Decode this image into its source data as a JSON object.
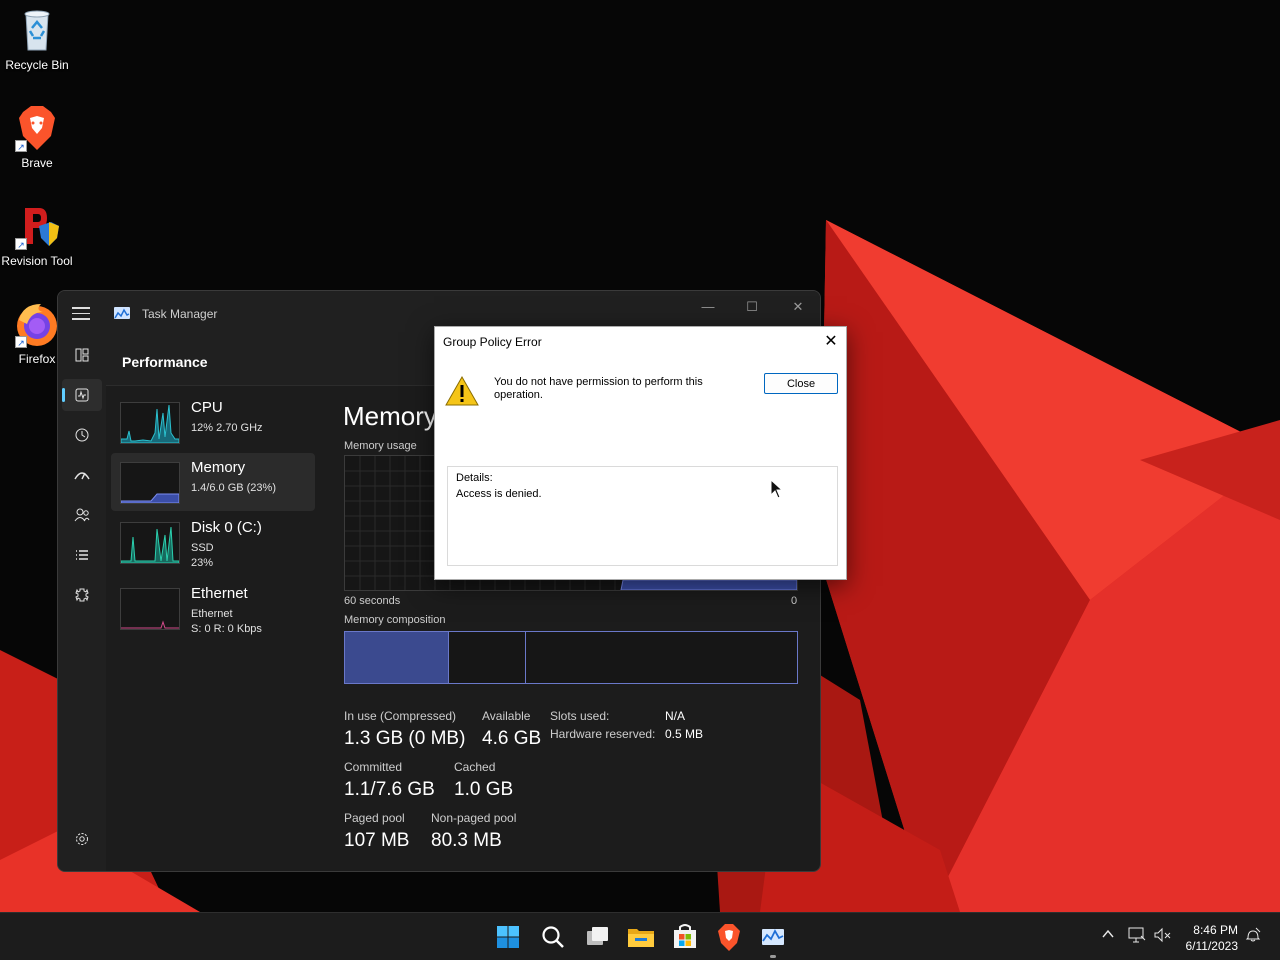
{
  "desktop": {
    "icons": [
      {
        "label": "Recycle Bin",
        "icon": "recycle-bin-icon"
      },
      {
        "label": "Brave",
        "icon": "brave-icon"
      },
      {
        "label": "Revision Tool",
        "icon": "revision-tool-icon"
      },
      {
        "label": "Firefox",
        "icon": "firefox-icon"
      }
    ]
  },
  "task_manager": {
    "title": "Task Manager",
    "section_title": "Performance",
    "window_buttons": {
      "minimize": "—",
      "maximize": "☐",
      "close": "✕"
    },
    "nav_icons": [
      "processes-icon",
      "performance-icon",
      "app-history-icon",
      "startup-apps-icon",
      "users-icon",
      "details-icon",
      "services-icon",
      "settings-icon"
    ],
    "perf_list": [
      {
        "name": "CPU",
        "line1": "12%  2.70 GHz",
        "line2": ""
      },
      {
        "name": "Memory",
        "line1": "1.4/6.0 GB (23%)",
        "line2": ""
      },
      {
        "name": "Disk 0 (C:)",
        "line1": "SSD",
        "line2": "23%"
      },
      {
        "name": "Ethernet",
        "line1": "Ethernet",
        "line2": "S: 0  R: 0 Kbps"
      }
    ],
    "memory": {
      "heading": "Memory",
      "usage_label": "Memory usage",
      "x_left": "60 seconds",
      "x_right": "0",
      "composition_label": "Memory composition",
      "stats": {
        "in_use_label": "In use (Compressed)",
        "in_use_value": "1.3 GB (0 MB)",
        "available_label": "Available",
        "available_value": "4.6 GB",
        "committed_label": "Committed",
        "committed_value": "1.1/7.6 GB",
        "cached_label": "Cached",
        "cached_value": "1.0 GB",
        "paged_label": "Paged pool",
        "paged_value": "107 MB",
        "nonpaged_label": "Non-paged pool",
        "nonpaged_value": "80.3 MB",
        "slots_label": "Slots used:",
        "slots_value": "N/A",
        "hw_reserved_label": "Hardware reserved:",
        "hw_reserved_value": "0.5 MB"
      }
    }
  },
  "dialog": {
    "title": "Group Policy Error",
    "message": "You do not have permission to perform this operation.",
    "close_button": "Close",
    "details_label": "Details:",
    "details_text": "Access is denied."
  },
  "taskbar": {
    "apps": [
      "start-icon",
      "search-icon",
      "task-view-icon",
      "file-explorer-icon",
      "store-icon",
      "brave-icon",
      "task-manager-icon"
    ],
    "tray_icons": [
      "chevron-up-icon",
      "network-icon",
      "volume-muted-icon",
      "notification-icon"
    ],
    "time": "8:46 PM",
    "date": "6/11/2023"
  }
}
